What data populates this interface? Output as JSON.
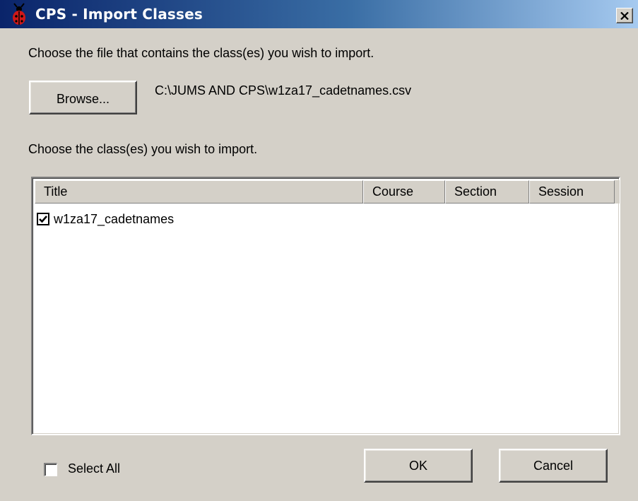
{
  "window": {
    "title": "CPS - Import Classes",
    "close_glyph": "✕"
  },
  "instructions": {
    "file_prompt": "Choose the file that contains the class(es) you wish to import.",
    "class_prompt": "Choose the class(es) you wish to import."
  },
  "file": {
    "browse_label": "Browse...",
    "path": "C:\\JUMS AND CPS\\w1za17_cadetnames.csv"
  },
  "list": {
    "columns": [
      "Title",
      "Course",
      "Section",
      "Session"
    ],
    "rows": [
      {
        "title": "w1za17_cadetnames",
        "course": "",
        "section": "",
        "session": "",
        "checked": true
      }
    ]
  },
  "footer": {
    "select_all_label": "Select All",
    "select_all_checked": false,
    "ok_label": "OK",
    "cancel_label": "Cancel"
  },
  "colors": {
    "titlebar_start": "#0a246a",
    "titlebar_end": "#a6caf0",
    "face": "#d4d0c8"
  },
  "icons": {
    "app": "ladybug-app-icon",
    "close": "close-icon",
    "check": "checkmark-icon"
  }
}
